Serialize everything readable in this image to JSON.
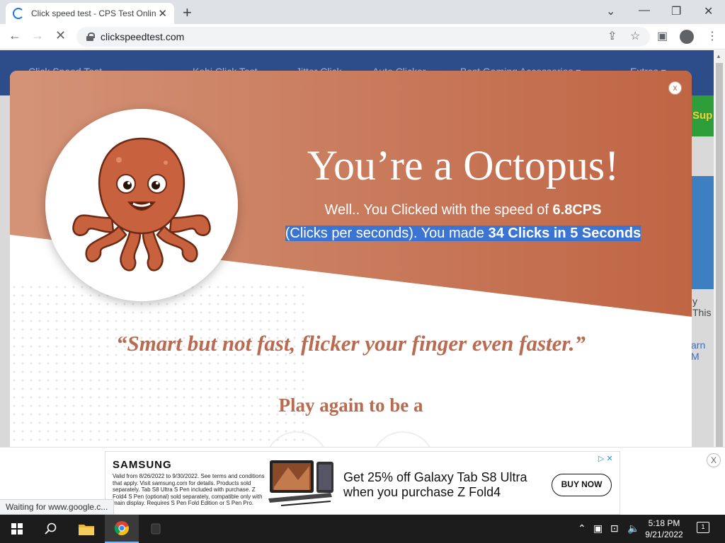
{
  "browser": {
    "tab_title": "Click speed test - CPS Test Online",
    "tab_close": "✕",
    "new_tab": "+",
    "minimize": "—",
    "maximize": "❐",
    "close": "✕",
    "url": "clickspeedtest.com",
    "back": "←",
    "forward": "→",
    "stop": "✕",
    "status": "Waiting for www.google.c..."
  },
  "site": {
    "nav": [
      "Click Speed Test",
      "Kohi Click Test",
      "Jitter Click",
      "Auto Clicker",
      "Best Gaming Accessories ▾",
      "Extras ▾"
    ],
    "green_text": "Sup",
    "side_text_1": "y This",
    "side_text_2": "arn M"
  },
  "modal": {
    "close": "x",
    "title": "You’re a Octopus!",
    "line1_prefix": "Well.. You Clicked with the speed of ",
    "line1_value": "6.8CPS",
    "line2_prefix": "(Clicks per seconds). You made ",
    "line2_value": "34 Clicks in 5 Seconds",
    "quote": "“Smart but not fast, flicker your finger even faster.”",
    "play_again": "Play again to be a",
    "colors": {
      "band": "#c0684a",
      "text_accent": "#b86b50",
      "highlight": "#3b74d1"
    }
  },
  "ad": {
    "brand": "SAMSUNG",
    "legal": "Valid from 8/26/2022 to 9/30/2022. See terms and conditions that apply. Visit samsung.com for details. Products sold separately. Tab S8 Ultra S Pen included with purchase. Z Fold4 S Pen (optional) sold separately, compatible only with main display. Requires S Pen Fold Edition or S Pen Pro.",
    "headline": "Get 25% off Galaxy Tab S8 Ultra when you purchase Z Fold4",
    "cta": "BUY NOW",
    "adchoices": "▷ ✕",
    "close": "X"
  },
  "taskbar": {
    "time": "5:18 PM",
    "date": "9/21/2022",
    "notifications": "1",
    "icons": [
      "windows-start-icon",
      "search-icon",
      "file-explorer-icon",
      "chrome-icon",
      "app-icon"
    ]
  }
}
